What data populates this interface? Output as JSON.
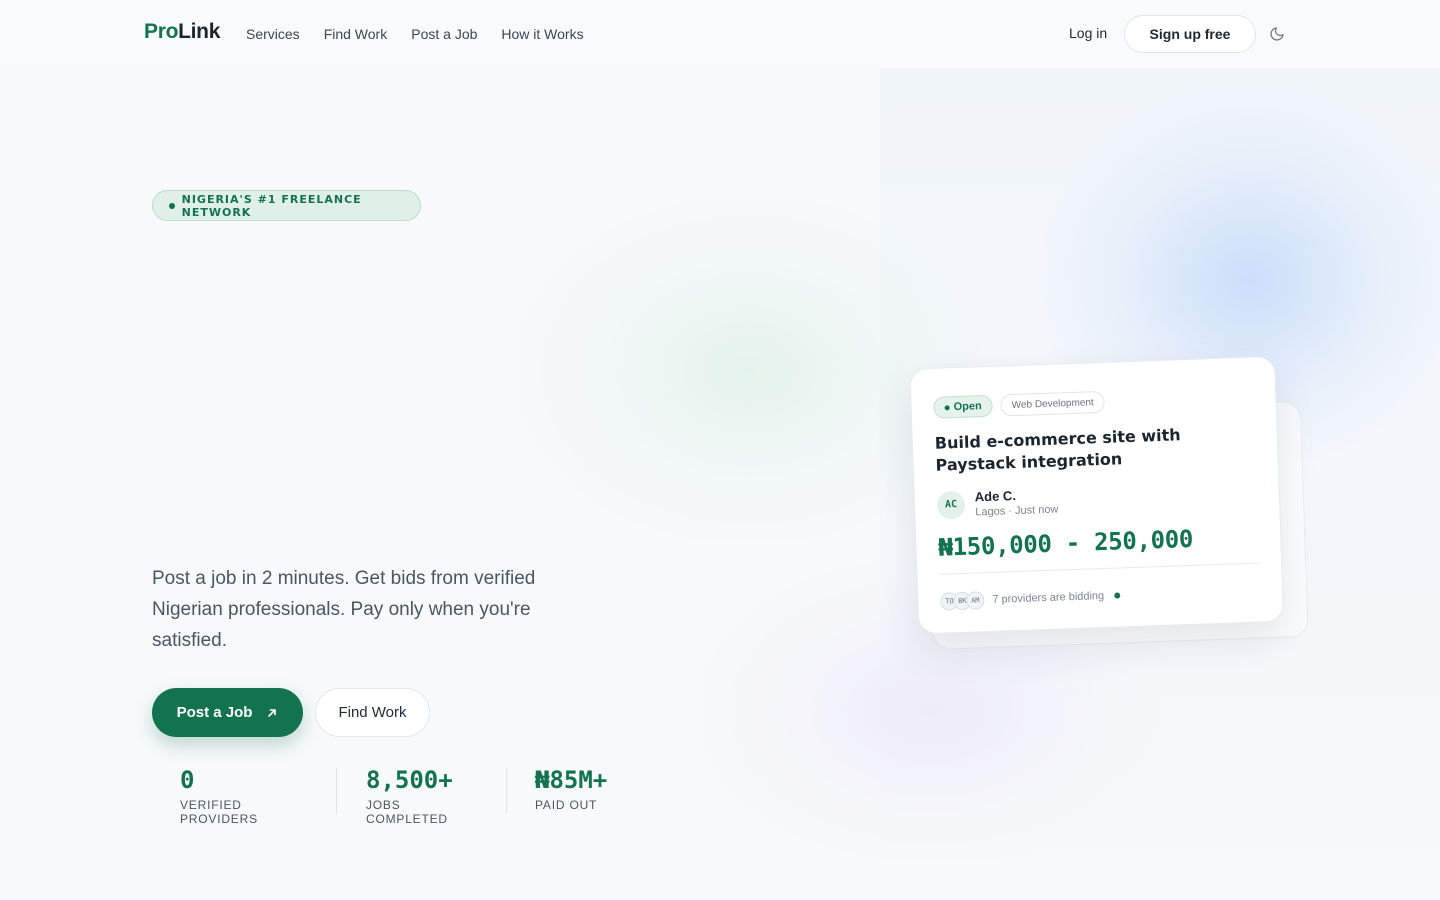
{
  "nav": {
    "logo_pro": "Pro",
    "logo_link": "Link",
    "links": [
      "Services",
      "Find Work",
      "Post a Job",
      "How it Works"
    ],
    "login": "Log in",
    "signup": "Sign up free"
  },
  "hero": {
    "badge": "NIGERIA'S #1 FREELANCE NETWORK",
    "description": "Post a job in 2 minutes. Get bids from verified Nigerian professionals. Pay only when you're satisfied.",
    "primary_cta": "Post a Job",
    "secondary_cta": "Find Work"
  },
  "stats": [
    {
      "value": "0",
      "label": "VERIFIED PROVIDERS"
    },
    {
      "value": "8,500+",
      "label": "JOBS COMPLETED"
    },
    {
      "value": "₦85M+",
      "label": "PAID OUT"
    }
  ],
  "job_card": {
    "status": "Open",
    "category": "Web Development",
    "title": "Build e-commerce site with Paystack integration",
    "poster_initials": "AC",
    "poster_name": "Ade C.",
    "poster_meta": "Lagos · Just now",
    "price": "₦150,000 - 250,000",
    "bidder_initials": [
      "TO",
      "BK",
      "AM"
    ],
    "bidding_text": "7 providers are bidding"
  },
  "colors": {
    "brand": "#13734f",
    "text": "#1f2933",
    "muted": "#4a5663"
  },
  "icons": {
    "theme_toggle": "moon-icon",
    "cta_arrow": "arrow-up-right-icon"
  }
}
